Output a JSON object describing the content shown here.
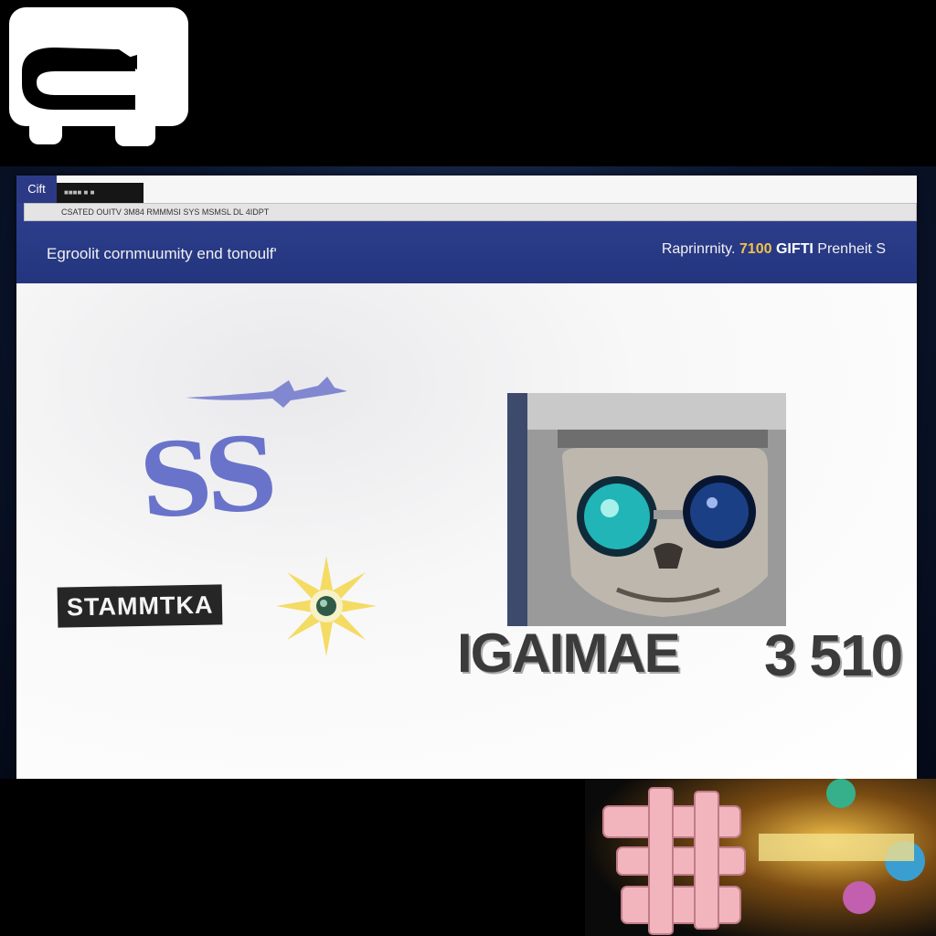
{
  "logo": {
    "icon": "app-logo"
  },
  "browser": {
    "tab_label": "Cift",
    "secondary_tab_label": "■■■■ ■ ■",
    "address_text": "CSATED OUITV 3M84 RMMMSI SYS MSMSL DL 4IDPT"
  },
  "header": {
    "tagline": "Egroolit cornmuumity end tonoulf'",
    "stats_prefix": "Raprinrnity.",
    "stats_value": "7100",
    "stats_gift": "GIFTI",
    "stats_suffix": "Prenheit S"
  },
  "content": {
    "glyph_text": "SS",
    "stamp_text": "STAMMTKA",
    "game_title": "IGAIMAE",
    "game_number": "3 510"
  },
  "colors": {
    "header_bg": "#2e3f8f",
    "stats_accent": "#f2c14c",
    "glyph": "#5c66c6",
    "stamp_bg": "#262626"
  }
}
